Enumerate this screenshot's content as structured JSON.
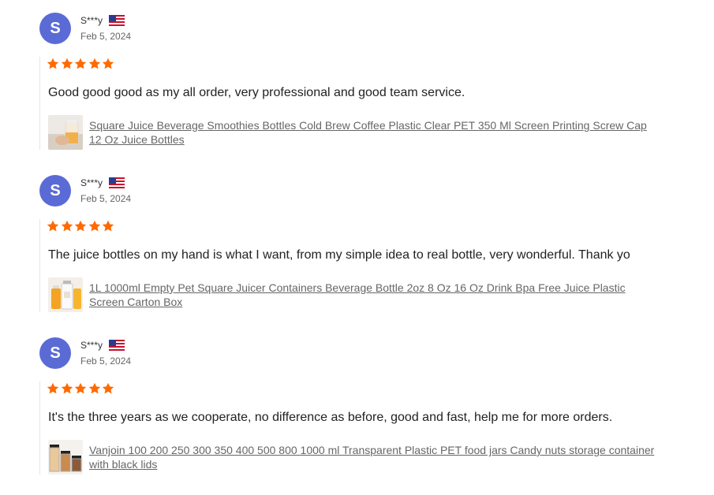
{
  "reviews": [
    {
      "avatar_letter": "S",
      "user_name": "S***y",
      "country_flag": "us-flag-icon",
      "date": "Feb 5, 2024",
      "rating": 5,
      "text": "Good good good as my all order, very professional and good team service.",
      "product_name": "Square Juice Beverage Smoothies Bottles Cold Brew Coffee Plastic Clear PET 350 Ml Screen Printing Screw Cap 12 Oz Juice Bottles",
      "thumbnail": "juice-bottle-hand-thumbnail"
    },
    {
      "avatar_letter": "S",
      "user_name": "S***y",
      "country_flag": "us-flag-icon",
      "date": "Feb 5, 2024",
      "rating": 5,
      "text": "The juice bottles on my hand is what I want, from my simple idea to real bottle, very wonderful. Thank yo",
      "product_name": "1L 1000ml Empty Pet Square Juicer Containers Beverage Bottle 2oz 8 Oz 16 Oz Drink Bpa Free Juice Plastic Screen Carton Box",
      "thumbnail": "orange-juice-bottles-thumbnail"
    },
    {
      "avatar_letter": "S",
      "user_name": "S***y",
      "country_flag": "us-flag-icon",
      "date": "Feb 5, 2024",
      "rating": 5,
      "text": "It's the three years as we cooperate, no difference as before, good and fast, help me for more orders.",
      "product_name": "Vanjoin 100 200 250 300 350 400 500 800 1000 ml Transparent Plastic PET food jars Candy nuts storage container with black lids",
      "thumbnail": "food-jars-thumbnail"
    }
  ],
  "colors": {
    "avatar": "#5b6bd5",
    "star": "#ff6a00",
    "link": "#666666",
    "divider": "#e6e6e6"
  }
}
